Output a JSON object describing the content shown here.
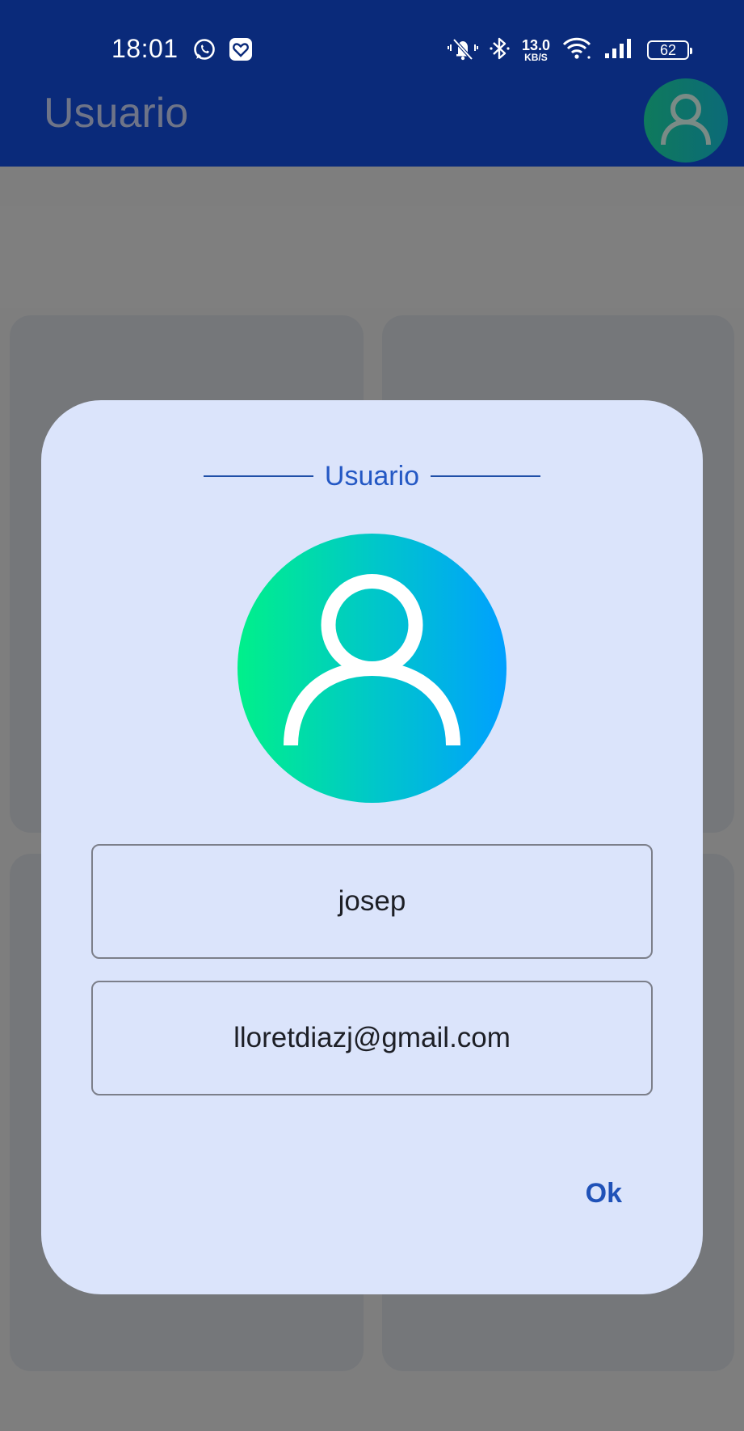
{
  "status_bar": {
    "time": "18:01",
    "left_icons": [
      "whatsapp-icon",
      "heart-app-icon"
    ],
    "right_icons": [
      "silent-icon",
      "bluetooth-icon",
      "wifi-icon",
      "signal-icon"
    ],
    "net_speed_value": "13.0",
    "net_speed_unit": "KB/S",
    "battery": "62"
  },
  "app_bar": {
    "title": "Usuario",
    "avatar_icon": "user-avatar-icon"
  },
  "dialog": {
    "title": "Usuario",
    "avatar_icon": "user-avatar-icon",
    "username": "josep",
    "email": "lloretdiazj@gmail.com",
    "ok_label": "Ok"
  },
  "colors": {
    "app_bar": "#0a2a7a",
    "dialog_bg": "#dbe4fb",
    "accent": "#2458c4",
    "avatar_gradient_start": "#00f08a",
    "avatar_gradient_end": "#00a0ff"
  }
}
